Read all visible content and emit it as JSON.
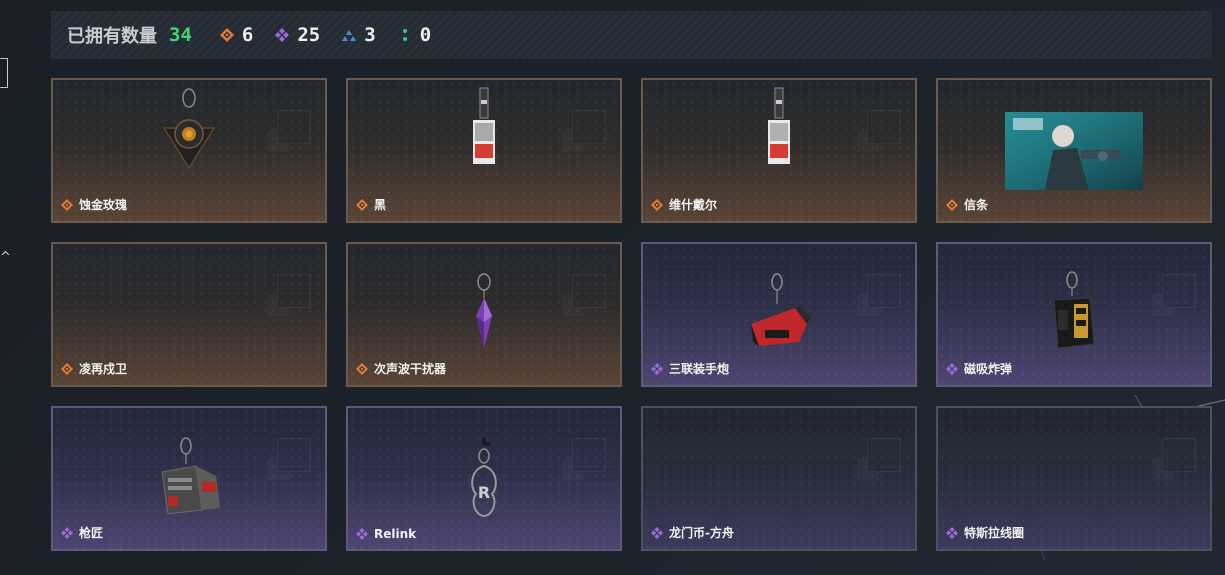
{
  "summary": {
    "label": "已拥有数量",
    "total": "34",
    "counts": [
      {
        "rarity": "orange",
        "value": "6",
        "color": "#e07a3a",
        "icon": "diamond-orange-icon"
      },
      {
        "rarity": "purple",
        "value": "25",
        "color": "#9b6bd8",
        "icon": "diamond-purple-icon"
      },
      {
        "rarity": "blue",
        "value": "3",
        "color": "#4a8ed8",
        "icon": "triangle-blue-icon"
      },
      {
        "rarity": "green",
        "value": "0",
        "color": "#3fc48a",
        "icon": "dots-green-icon"
      }
    ]
  },
  "items": [
    {
      "name": "蚀金玫瑰",
      "rarity": "orange",
      "art": "rose-pendant"
    },
    {
      "name": "黑",
      "rarity": "orange",
      "art": "card-pendant"
    },
    {
      "name": "维什戴尔",
      "rarity": "orange",
      "art": "card-pendant"
    },
    {
      "name": "信条",
      "rarity": "orange",
      "art": "poster"
    },
    {
      "name": "凌再戍卫",
      "rarity": "orange",
      "art": ""
    },
    {
      "name": "次声波干扰器",
      "rarity": "orange",
      "art": "crystal-pendant"
    },
    {
      "name": "三联装手炮",
      "rarity": "purple",
      "art": "cannon-pendant"
    },
    {
      "name": "磁吸炸弹",
      "rarity": "purple",
      "art": "bomb-pendant"
    },
    {
      "name": "枪匠",
      "rarity": "purple",
      "art": "box-pendant"
    },
    {
      "name": "Relink",
      "rarity": "purple",
      "art": "r-pendant"
    },
    {
      "name": "龙门币-方舟",
      "rarity": "purple",
      "art": ""
    },
    {
      "name": "特斯拉线圈",
      "rarity": "purple",
      "art": ""
    }
  ]
}
